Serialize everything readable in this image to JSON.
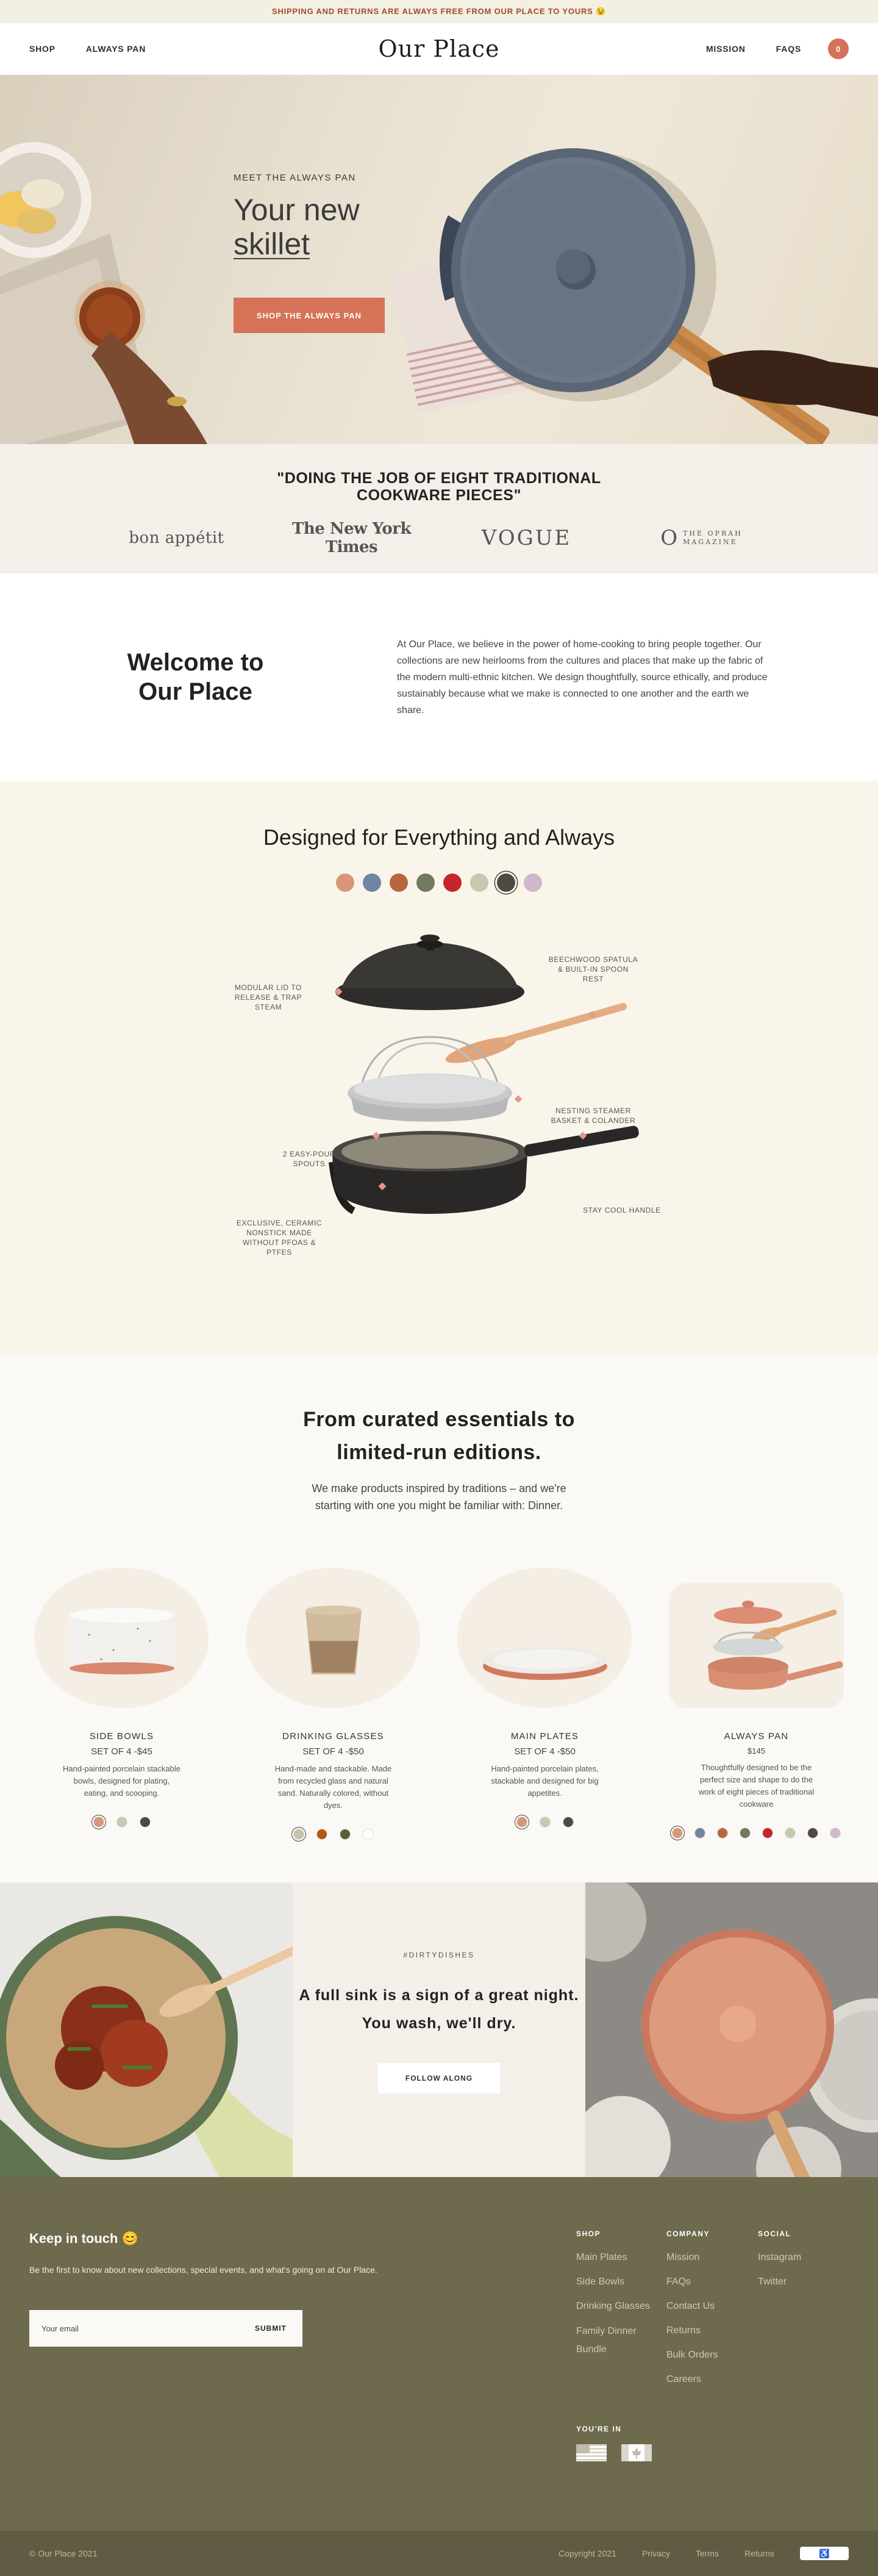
{
  "announcement": "SHIPPING AND RETURNS ARE ALWAYS FREE FROM OUR PLACE TO YOURS 😉",
  "nav": {
    "left": [
      "SHOP",
      "ALWAYS PAN"
    ],
    "logo": "Our Place",
    "right": [
      "MISSION",
      "FAQS"
    ],
    "cart_count": "0"
  },
  "hero": {
    "eyebrow": "MEET THE ALWAYS PAN",
    "title_line1": "Your new",
    "title_line2": "skillet",
    "button": "SHOP THE ALWAYS PAN"
  },
  "press": {
    "quote": "\"DOING THE JOB OF EIGHT TRADITIONAL COOKWARE PIECES\"",
    "logos": [
      "bon appétit",
      "The New York Times",
      "VOGUE",
      "O",
      "THE OPRAH",
      "MAGAZINE"
    ]
  },
  "welcome": {
    "title": "Welcome to Our Place",
    "body": "At Our Place, we believe in the power of home-cooking to bring people together. Our collections are new heirlooms from the cultures and places that make up the fabric of the modern multi-ethnic kitchen. We design thoughtfully, source ethically, and produce sustainably because what we make is connected to one another and the earth we share."
  },
  "designed": {
    "title": "Designed for Everything and Always",
    "colors": [
      "#d8967b",
      "#6f86a1",
      "#b8663f",
      "#6f7a5f",
      "#c4262b",
      "#c5c9ae",
      "#4d4a45",
      "#cfb8cc"
    ],
    "selected_color_index": 6,
    "callouts": {
      "lid": "MODULAR LID TO RELEASE & TRAP STEAM",
      "spatula": "BEECHWOOD SPATULA & BUILT-IN SPOON REST",
      "steamer": "NESTING STEAMER BASKET & COLANDER",
      "spouts": "2 EASY-POUR SPOUTS",
      "handle": "STAY COOL HANDLE",
      "coating": "EXCLUSIVE, CERAMIC NONSTICK MADE WITHOUT PFOAS & PTFES"
    }
  },
  "curated": {
    "title_line1": "From curated essentials to",
    "title_line2": "limited-run editions.",
    "subtitle_line1": "We make products inspired by traditions – and we're",
    "subtitle_line2": "starting with one you might be familiar with: Dinner.",
    "products": [
      {
        "name": "SIDE BOWLS",
        "price": "SET OF 4 -$45",
        "desc": "Hand-painted porcelain stackable bowls, designed for plating, eating, and scooping.",
        "swatches": [
          "#d8967b",
          "#c5c9ae",
          "#4d4a45"
        ]
      },
      {
        "name": "DRINKING GLASSES",
        "price": "SET OF 4 -$50",
        "desc": "Hand-made and stackable. Made from recycled glass and natural sand. Naturally colored, without dyes.",
        "swatches": [
          "#c9c3a6",
          "#b3580e",
          "#58622f",
          "#ffffff"
        ]
      },
      {
        "name": "MAIN PLATES",
        "price": "SET OF 4 -$50",
        "desc": "Hand-painted porcelain plates, stackable and designed for big appetites.",
        "swatches": [
          "#d8967b",
          "#c5c9ae",
          "#4d4a45"
        ]
      },
      {
        "name": "ALWAYS PAN",
        "price": "$145",
        "desc": "Thoughtfully designed to be the perfect size and shape to do the work of eight pieces of traditional cookware",
        "swatches": [
          "#d8967b",
          "#6f86a1",
          "#b8663f",
          "#6f7a5f",
          "#c4262b",
          "#c5c9ae",
          "#4d4a45",
          "#cfb8cc"
        ]
      }
    ]
  },
  "dishes": {
    "tag": "#DIRTYDISHES",
    "line1": "A full sink is a sign of a great night.",
    "line2": "You wash, we'll dry.",
    "button": "FOLLOW ALONG"
  },
  "footer": {
    "title": "Keep in touch 😊",
    "blurb": "Be the first to know about new collections, special events, and what's going on at Our Place.",
    "email_placeholder": "Your email",
    "submit": "SUBMIT",
    "columns": [
      {
        "heading": "SHOP",
        "links": [
          "Main Plates",
          "Side Bowls",
          "Drinking Glasses",
          "Family Dinner Bundle"
        ]
      },
      {
        "heading": "COMPANY",
        "links": [
          "Mission",
          "FAQs",
          "Contact Us",
          "Returns",
          "Bulk Orders",
          "Careers"
        ]
      },
      {
        "heading": "SOCIAL",
        "links": [
          "Instagram",
          "Twitter"
        ]
      }
    ],
    "youre_in": "YOU'RE IN",
    "copyright_left": "© Our Place 2021",
    "bottom_links": [
      "Copyright 2021",
      "Privacy",
      "Terms",
      "Returns"
    ]
  }
}
